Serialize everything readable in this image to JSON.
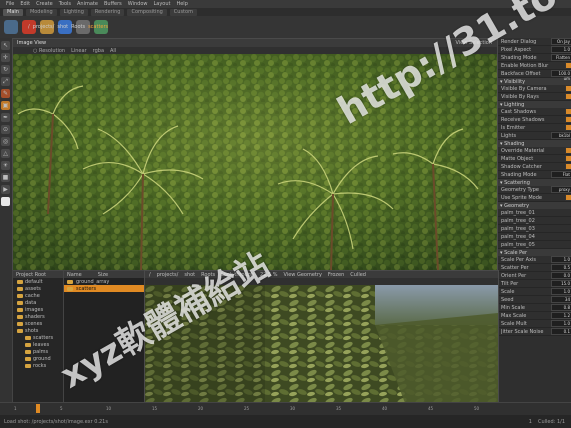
{
  "menubar": {
    "items": [
      "File",
      "Edit",
      "Create",
      "Tools",
      "Animate",
      "Buffers",
      "Window",
      "Layout",
      "Help"
    ]
  },
  "desktop_tabs": [
    {
      "label": "Main",
      "active": true
    },
    {
      "label": "Modeling",
      "active": false
    },
    {
      "label": "Lighting",
      "active": false
    },
    {
      "label": "Rendering",
      "active": false
    },
    {
      "label": "Compositing",
      "active": false
    },
    {
      "label": "Custom",
      "active": false
    }
  ],
  "shelf": {
    "tools": [
      {
        "name": "grid-icon",
        "color": "#4a6a8a"
      },
      {
        "name": "sphere-red-icon",
        "color": "#c23a2a"
      },
      {
        "name": "teapot-icon",
        "color": "#b88a3a"
      },
      {
        "name": "diamond-blue-icon",
        "color": "#3a6fc2"
      },
      {
        "name": "torus-icon",
        "color": "#6a6a6a"
      },
      {
        "name": "globe-icon",
        "color": "#4a8a5a"
      }
    ]
  },
  "breadcrumb": {
    "items": [
      "/",
      "projects/",
      "shot",
      "Roots"
    ],
    "selected": "scatters"
  },
  "viewport_top": {
    "title": "Image View",
    "subheader": [
      "○ Resolution",
      "Linear",
      "rgba",
      "All"
    ],
    "right_label": "View Selection"
  },
  "attributes": {
    "rows": [
      {
        "label": "Render Dialog",
        "value": "On Jay",
        "type": "val"
      },
      {
        "label": "Pixel Aspect",
        "value": "1.0",
        "type": "val"
      },
      {
        "label": "Shading Mode",
        "value": "Flatten",
        "type": "val"
      },
      {
        "label": "Enable Motion Blur",
        "type": "chk"
      },
      {
        "label": "Backface Offset",
        "value": "100.0 um",
        "type": "val"
      },
      {
        "section": "Visibility"
      },
      {
        "label": "Visible By Camera",
        "type": "chk"
      },
      {
        "label": "Visible By Rays",
        "type": "chk"
      },
      {
        "section": "Lighting"
      },
      {
        "label": "Cast Shadows",
        "type": "chk"
      },
      {
        "label": "Receive Shadows",
        "type": "chk"
      },
      {
        "label": "Is Emitter",
        "type": "chk"
      },
      {
        "label": "Lights",
        "value": "bk1bl",
        "type": "val"
      },
      {
        "section": "Shading"
      },
      {
        "label": "Override Material",
        "type": "chk"
      },
      {
        "label": "Matte Object",
        "type": "chk"
      },
      {
        "label": "Shadow Catcher",
        "type": "chk"
      },
      {
        "label": "Shading Mode",
        "value": "Flat",
        "type": "val"
      },
      {
        "section": "Scattering"
      },
      {
        "label": "Geometry Type",
        "value": "proxy",
        "type": "val"
      },
      {
        "label": "Use Sprite Mode",
        "type": "chk"
      },
      {
        "section": "Geometry"
      },
      {
        "label": "palm_tree_01",
        "type": "list"
      },
      {
        "label": "palm_tree_02",
        "type": "list"
      },
      {
        "label": "palm_tree_03",
        "type": "list"
      },
      {
        "label": "palm_tree_04",
        "type": "list"
      },
      {
        "label": "palm_tree_05",
        "type": "list"
      },
      {
        "section": "Scale Per"
      },
      {
        "label": "Scale Per Axis",
        "value": "1.0",
        "type": "val"
      },
      {
        "label": "Scatter Per",
        "value": "0.5",
        "type": "val"
      },
      {
        "label": "Orient Per",
        "value": "0.0",
        "type": "val"
      },
      {
        "label": "Tilt Per",
        "value": "15.0",
        "type": "val"
      },
      {
        "label": "Scale",
        "value": "1.0",
        "type": "val"
      },
      {
        "label": "Seed",
        "value": "34",
        "type": "val"
      },
      {
        "label": "Min Scale",
        "value": "0.8",
        "type": "val"
      },
      {
        "label": "Max Scale",
        "value": "1.2",
        "type": "val"
      },
      {
        "label": "Scale Mult",
        "value": "1.0",
        "type": "val"
      },
      {
        "label": "Jitter Scale Noise",
        "value": "0.1",
        "type": "val"
      }
    ]
  },
  "browser": {
    "title": "Browse",
    "tree_header": "Project Root",
    "tree": [
      "default",
      "assets",
      "cache",
      "data",
      "images",
      "shaders",
      "scenes",
      "shots",
      "scatters",
      "leaves",
      "palms",
      "ground",
      "rocks"
    ],
    "files_header": [
      "Name",
      "Size"
    ],
    "files": [
      {
        "name": "ground_array",
        "selected": false
      },
      {
        "name": "scatters",
        "selected": true
      }
    ]
  },
  "viewport_bottom": {
    "path": [
      "/",
      "projects/",
      "shot",
      "Roots"
    ],
    "camera": "Look through",
    "zoom": "22.5 %",
    "view_label": "View Geometry",
    "right_label": "Frozen",
    "status": "Culled"
  },
  "timeline": {
    "ticks": [
      "1",
      "5",
      "10",
      "15",
      "20",
      "25",
      "30",
      "35",
      "40",
      "45",
      "50"
    ],
    "current": "1"
  },
  "status": {
    "left": "Load shot: /projects/shot/image.exr 0.21s",
    "frame": "1",
    "right": "Culled: 1/1"
  },
  "watermarks": {
    "url": "http://31.to",
    "cn": "xyz軟體補給站"
  }
}
